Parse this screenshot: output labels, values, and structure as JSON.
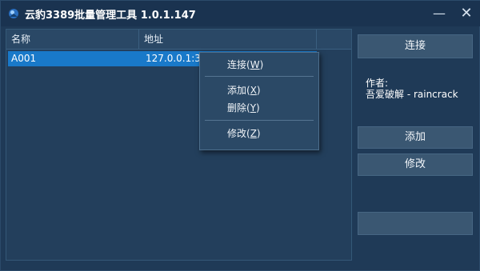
{
  "window": {
    "title": "云豹3389批量管理工具 1.0.1.147",
    "minimize_glyph": "—",
    "close_glyph": "✕"
  },
  "list": {
    "columns": [
      "名称",
      "地址"
    ],
    "rows": [
      {
        "name": "A001",
        "address": "127.0.0.1:33"
      }
    ]
  },
  "sidebar": {
    "connect_label": "连接",
    "author_label": "作者:",
    "author_name": "吾爱破解 - raincrack",
    "add_label": "添加",
    "edit_label": "修改",
    "blank_label": ""
  },
  "context_menu": {
    "items": [
      {
        "text": "连接(",
        "key": "W",
        "tail": ")"
      },
      {
        "text": "添加(",
        "key": "X",
        "tail": ")"
      },
      {
        "text": "删除(",
        "key": "Y",
        "tail": ")"
      },
      {
        "text": "修改(",
        "key": "Z",
        "tail": ")"
      }
    ]
  },
  "icons": {
    "app": "app-logo-icon",
    "minimize": "minimize-icon",
    "close": "close-icon"
  },
  "colors": {
    "background": "#1f3a57",
    "selection": "#1979c9",
    "button": "#3a5772"
  }
}
